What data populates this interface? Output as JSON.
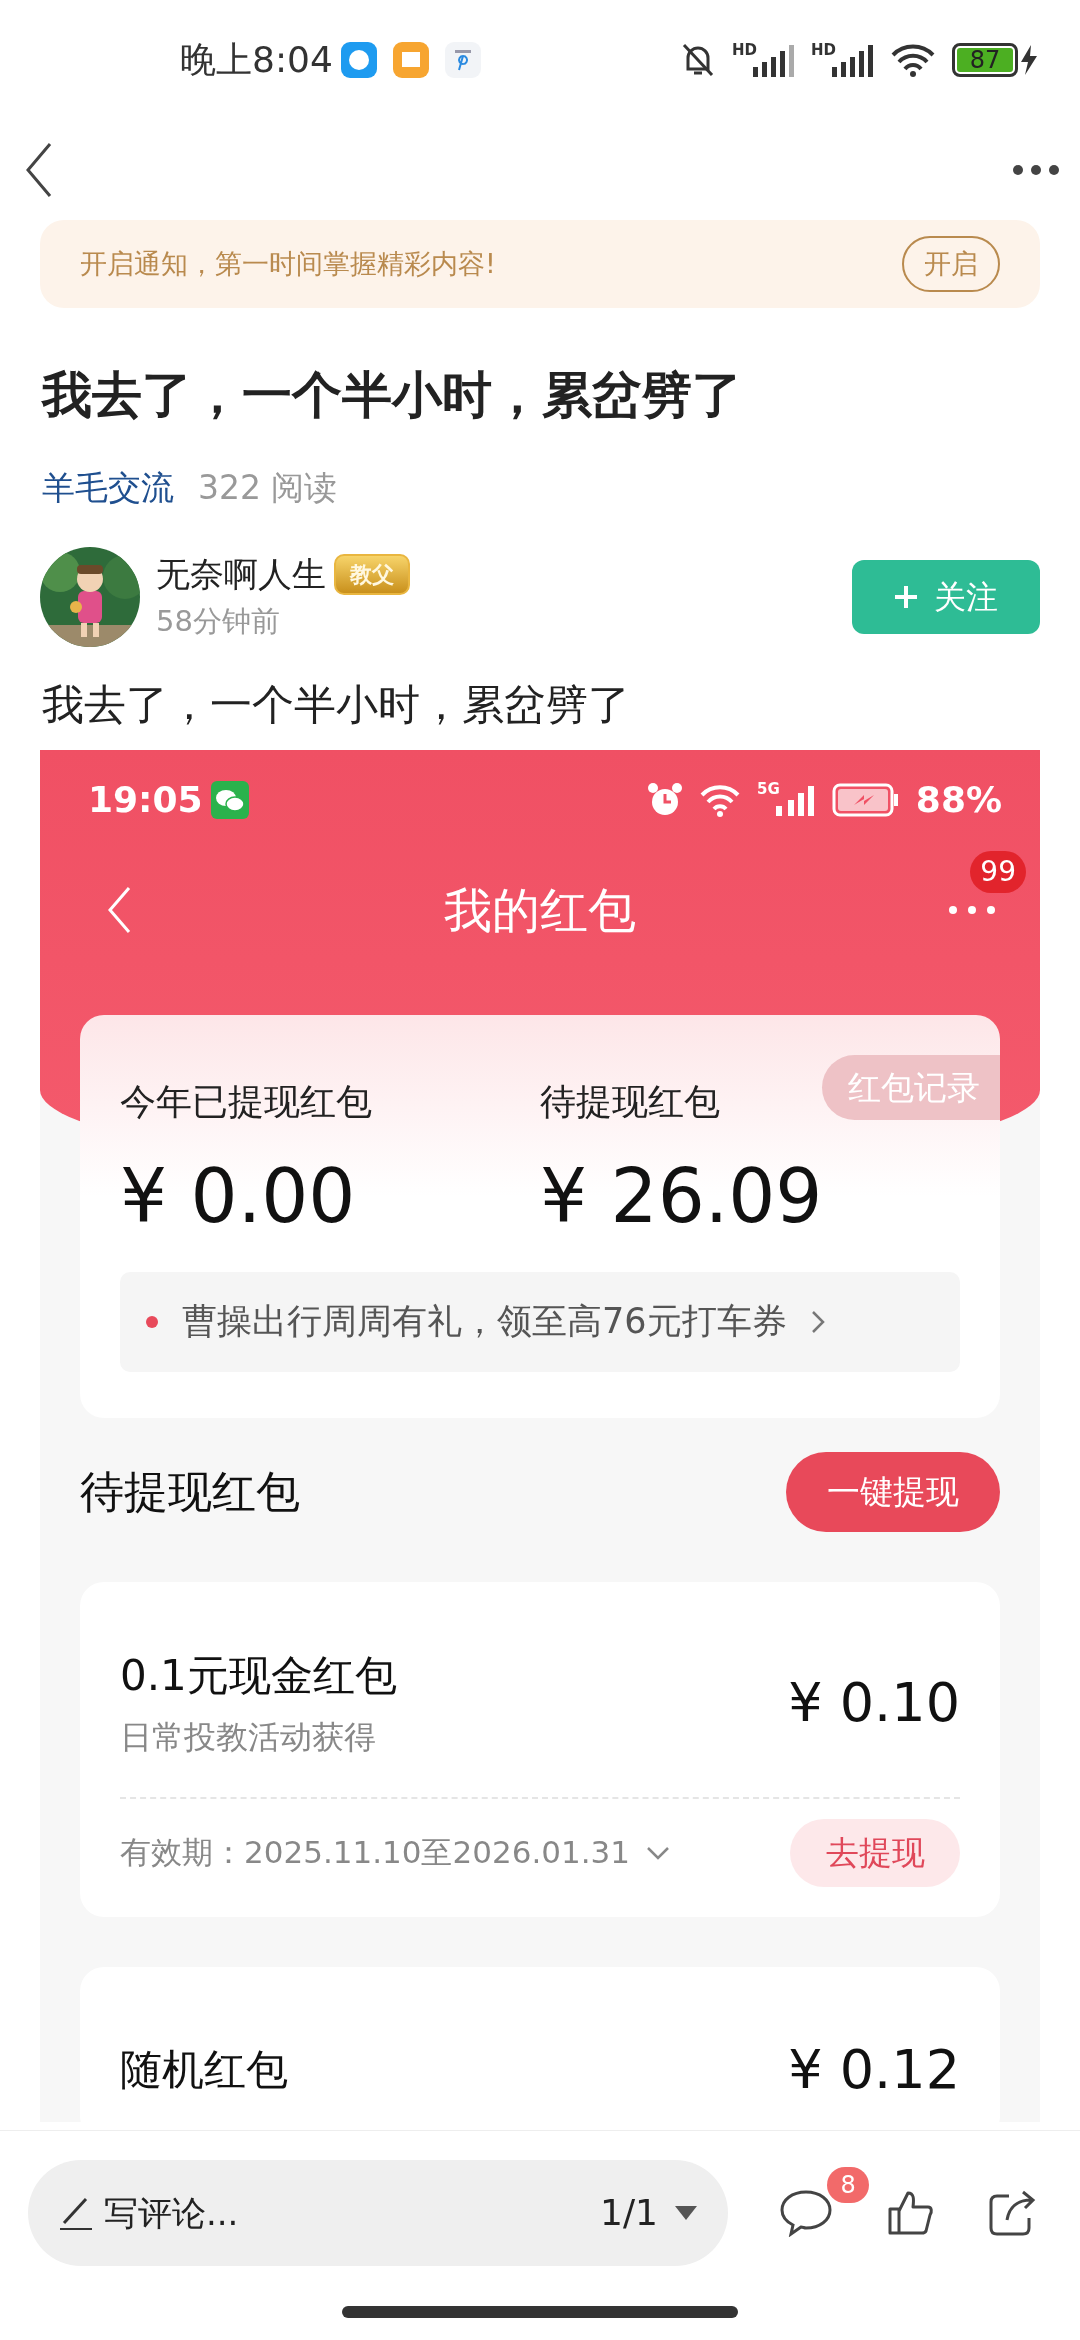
{
  "status_bar": {
    "time": "晚上8:04",
    "networks": [
      "HD",
      "HD"
    ],
    "battery": "87"
  },
  "notice": {
    "text": "开启通知，第一时间掌握精彩内容!",
    "button": "开启"
  },
  "post": {
    "title": "我去了，一个半小时，累岔劈了",
    "category": "羊毛交流",
    "reads": "322 阅读",
    "author": {
      "name": "无奈啊人生",
      "badge": "教父",
      "time": "58分钟前",
      "follow": "关注"
    },
    "body": "我去了，一个半小时，累岔劈了"
  },
  "screenshot": {
    "status": {
      "time": "19:05",
      "network": "5G",
      "battery": "88%"
    },
    "title": "我的红包",
    "more_badge": "99",
    "summary": {
      "record": "红包记录",
      "stats": [
        {
          "label": "今年已提现红包",
          "amount": "¥ 0.00"
        },
        {
          "label": "待提现红包",
          "amount": "¥ 26.09"
        }
      ],
      "promo": "曹操出行周周有礼，领至高76元打车券"
    },
    "section": {
      "title": "待提现红包",
      "button": "一键提现"
    },
    "packets": [
      {
        "name": "0.1元现金红包",
        "source": "日常投教活动获得",
        "amount": "¥ 0.10",
        "validity": "有效期：2025.11.10至2026.01.31",
        "action": "去提现"
      },
      {
        "name": "随机红包",
        "amount": "¥ 0.12"
      }
    ]
  },
  "comment_bar": {
    "placeholder": "写评论...",
    "page": "1/1",
    "comment_count": "8"
  }
}
